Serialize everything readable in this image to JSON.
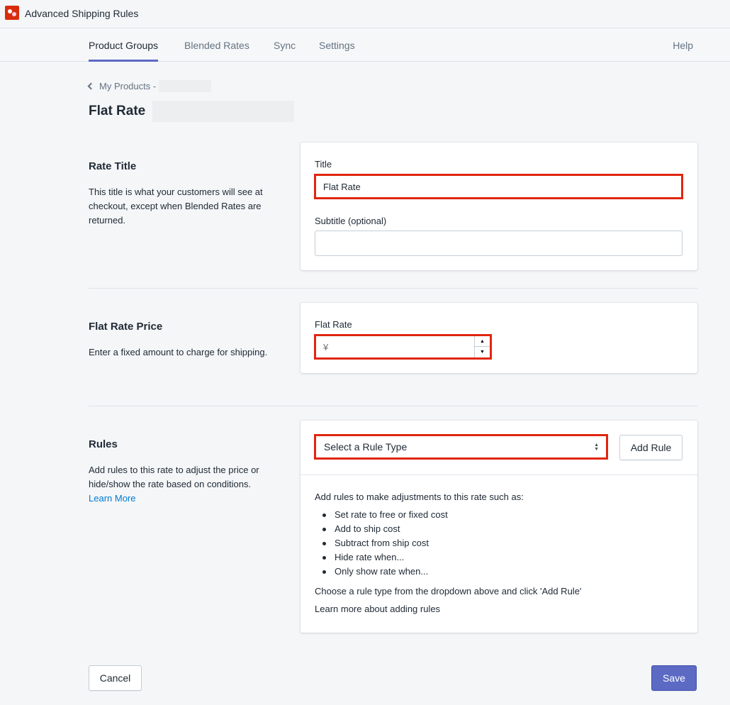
{
  "app": {
    "title": "Advanced Shipping Rules"
  },
  "nav": {
    "tabs": [
      "Product Groups",
      "Blended Rates",
      "Sync",
      "Settings"
    ],
    "help": "Help"
  },
  "breadcrumb": {
    "label": "My Products -"
  },
  "page": {
    "title": "Flat Rate"
  },
  "rate_title": {
    "heading": "Rate Title",
    "description": "This title is what your customers will see at checkout, except when Blended Rates are returned.",
    "title_label": "Title",
    "title_value": "Flat Rate",
    "subtitle_label": "Subtitle (optional)",
    "subtitle_value": ""
  },
  "flat_rate_price": {
    "heading": "Flat Rate Price",
    "description": "Enter a fixed amount to charge for shipping.",
    "field_label": "Flat Rate",
    "placeholder": "¥"
  },
  "rules": {
    "heading": "Rules",
    "description": "Add rules to this rate to adjust the price or hide/show the rate based on conditions.",
    "learn_more": "Learn More",
    "select_value": "Select a Rule Type",
    "add_button": "Add Rule",
    "intro": "Add rules to make adjustments to this rate such as:",
    "bullets": [
      "Set rate to free or fixed cost",
      "Add to ship cost",
      "Subtract from ship cost",
      "Hide rate when...",
      "Only show rate when..."
    ],
    "instruction": "Choose a rule type from the dropdown above and click 'Add Rule'",
    "learn_more_adding": "Learn more about adding rules"
  },
  "footer": {
    "cancel": "Cancel",
    "save": "Save"
  },
  "colors": {
    "accent": "#5c6ac4",
    "highlight": "#e0260f",
    "link": "#007ace"
  }
}
